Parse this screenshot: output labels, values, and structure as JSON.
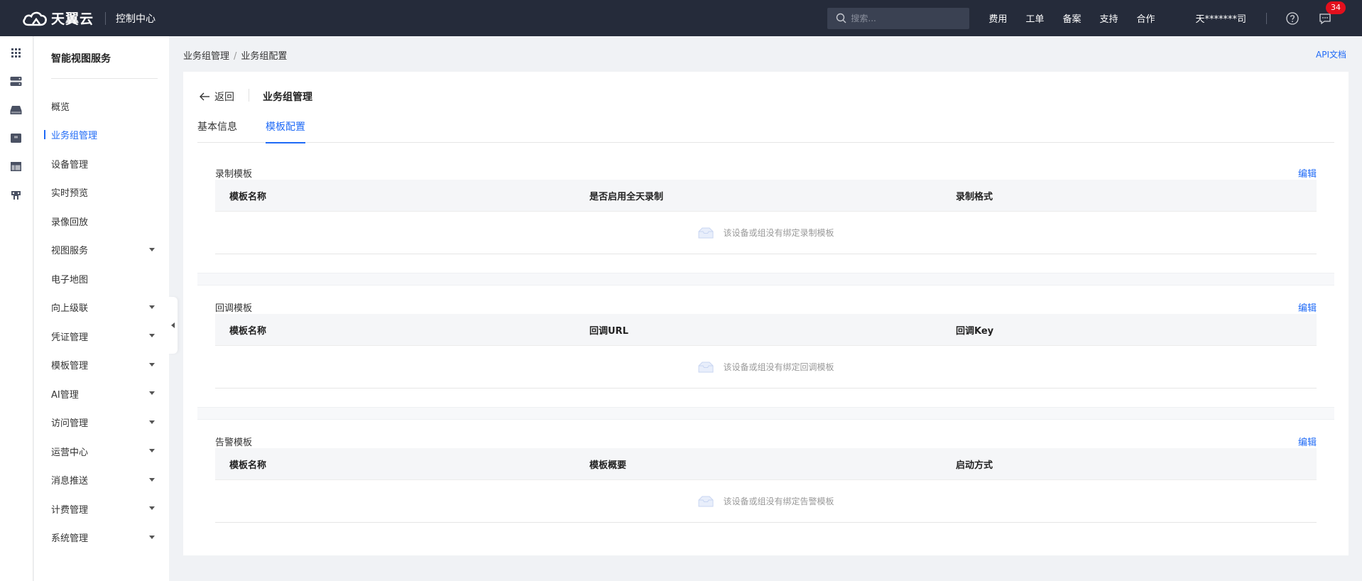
{
  "topbar": {
    "brand": "天翼云",
    "console": "控制中心",
    "search_placeholder": "搜索...",
    "links": [
      "费用",
      "工单",
      "备案",
      "支持",
      "合作"
    ],
    "user": "天*******司",
    "message_count": "34",
    "bg_color": "#252b3a"
  },
  "rail": {
    "icons": [
      "grid-icon",
      "server-icon",
      "storage-icon",
      "database-icon",
      "layout-icon",
      "elephant-icon"
    ]
  },
  "sidebar": {
    "title": "智能视图服务",
    "items": [
      {
        "label": "概览",
        "expandable": false,
        "active": false
      },
      {
        "label": "业务组管理",
        "expandable": false,
        "active": true
      },
      {
        "label": "设备管理",
        "expandable": false,
        "active": false
      },
      {
        "label": "实时预览",
        "expandable": false,
        "active": false
      },
      {
        "label": "录像回放",
        "expandable": false,
        "active": false
      },
      {
        "label": "视图服务",
        "expandable": true,
        "active": false
      },
      {
        "label": "电子地图",
        "expandable": false,
        "active": false
      },
      {
        "label": "向上级联",
        "expandable": true,
        "active": false
      },
      {
        "label": "凭证管理",
        "expandable": true,
        "active": false
      },
      {
        "label": "模板管理",
        "expandable": true,
        "active": false
      },
      {
        "label": "AI管理",
        "expandable": true,
        "active": false
      },
      {
        "label": "访问管理",
        "expandable": true,
        "active": false
      },
      {
        "label": "运营中心",
        "expandable": true,
        "active": false
      },
      {
        "label": "消息推送",
        "expandable": true,
        "active": false
      },
      {
        "label": "计费管理",
        "expandable": true,
        "active": false
      },
      {
        "label": "系统管理",
        "expandable": true,
        "active": false
      }
    ]
  },
  "breadcrumb": {
    "items": [
      "业务组管理",
      "业务组配置"
    ],
    "separator": "/"
  },
  "api_link": "API文档",
  "card": {
    "back_label": "返回",
    "title": "业务组管理",
    "tabs": [
      {
        "label": "基本信息",
        "active": false
      },
      {
        "label": "模板配置",
        "active": true
      }
    ],
    "sections": [
      {
        "title": "录制模板",
        "edit_label": "编辑",
        "columns": [
          "模板名称",
          "是否启用全天录制",
          "录制格式"
        ],
        "empty_text": "该设备或组没有绑定录制模板"
      },
      {
        "title": "回调模板",
        "edit_label": "编辑",
        "columns": [
          "模板名称",
          "回调URL",
          "回调Key"
        ],
        "empty_text": "该设备或组没有绑定回调模板"
      },
      {
        "title": "告警模板",
        "edit_label": "编辑",
        "columns": [
          "模板名称",
          "模板概要",
          "启动方式"
        ],
        "empty_text": "该设备或组没有绑定告警模板"
      }
    ]
  },
  "colors": {
    "accent": "#1f6af6",
    "badge": "#e3101d"
  }
}
